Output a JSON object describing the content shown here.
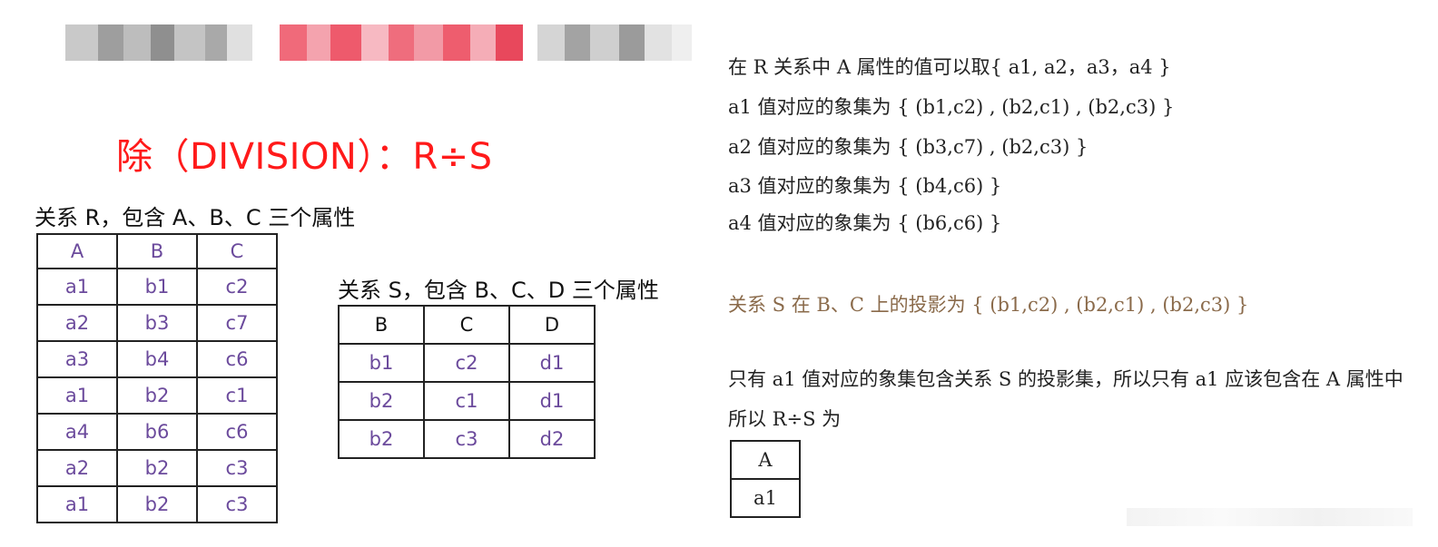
{
  "title": "除（DIVISION）：R÷S",
  "relation_r": {
    "caption": "关系 R，包含 A、B、C 三个属性",
    "columns": [
      "A",
      "B",
      "C"
    ],
    "rows": [
      [
        "a1",
        "b1",
        "c2"
      ],
      [
        "a2",
        "b3",
        "c7"
      ],
      [
        "a3",
        "b4",
        "c6"
      ],
      [
        "a1",
        "b2",
        "c1"
      ],
      [
        "a4",
        "b6",
        "c6"
      ],
      [
        "a2",
        "b2",
        "c3"
      ],
      [
        "a1",
        "b2",
        "c3"
      ]
    ]
  },
  "relation_s": {
    "caption": "关系 S，包含 B、C、D 三个属性",
    "columns": [
      "B",
      "C",
      "D"
    ],
    "rows": [
      [
        "b1",
        "c2",
        "d1"
      ],
      [
        "b2",
        "c1",
        "d1"
      ],
      [
        "b2",
        "c3",
        "d2"
      ]
    ]
  },
  "explanation": {
    "line1": "在 R 关系中 A 属性的值可以取{ a1, a2，a3，a4 }",
    "line2": "a1 值对应的象集为 {   (b1,c2)   , (b2,c1)  ,   (b2,c3)   }",
    "line3": "a2 值对应的象集为 {   (b3,c7)   , (b2,c3) }",
    "line4": "a3 值对应的象集为 {   (b4,c6)   }",
    "line5": "a4 值对应的象集为 {   (b6,c6)   }",
    "line6": "关系 S 在 B、C 上的投影为 {   (b1,c2)   , (b2,c1)  ,   (b2,c3)   }",
    "line7": "只有 a1 值对应的象集包含关系 S 的投影集，所以只有 a1 应该包含在 A 属性中",
    "line8": "所以 R÷S 为"
  },
  "result": {
    "columns": [
      "A"
    ],
    "rows": [
      [
        "a1"
      ]
    ]
  },
  "colors": {
    "title": "#ff1a1a",
    "cell_text": "#6b4a9c",
    "tan_text": "#8a6a4a"
  }
}
